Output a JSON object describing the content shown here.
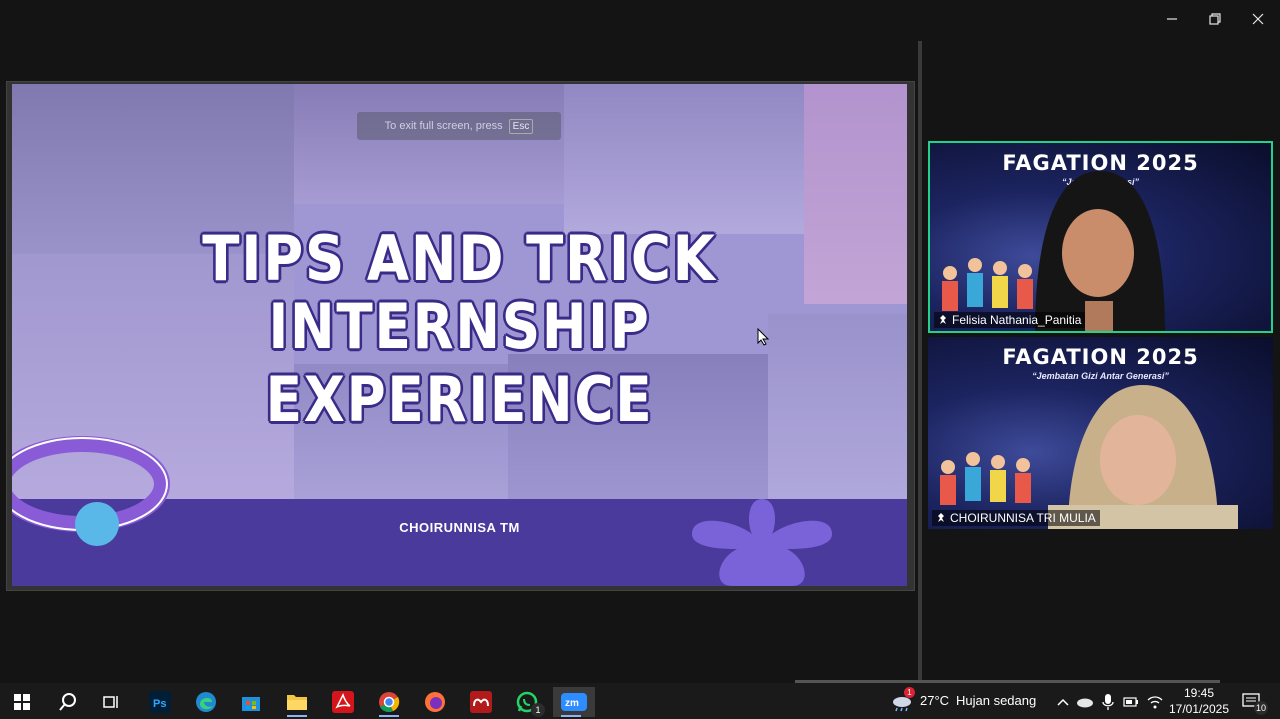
{
  "window_controls": {
    "minimize": "minimize",
    "restore": "restore",
    "close": "close"
  },
  "slide": {
    "esc_hint_text": "To exit full screen, press",
    "esc_key": "Esc",
    "title_line_1": "TIPS AND TRICK",
    "title_line_2": "INTERNSHIP EXPERIENCE",
    "presenter": "CHOIRUNNISA TM"
  },
  "participants": [
    {
      "event_title": "FAGATION 2025",
      "event_subtitle": "“Jem… Generasi”",
      "name": "Felisia Nathania_Panitia",
      "active_speaker": true
    },
    {
      "event_title": "FAGATION 2025",
      "event_subtitle": "“Jembatan Gizi Antar Generasi”",
      "name": "CHOIRUNNISA TRI MULIA",
      "active_speaker": false
    }
  ],
  "taskbar": {
    "apps": [
      "start",
      "search",
      "task-view",
      "photoshop",
      "edge",
      "store",
      "file-explorer",
      "acrobat",
      "chrome",
      "firefox",
      "mendeley",
      "whatsapp",
      "zoom"
    ],
    "whatsapp_badge": "1",
    "weather_badge": "1",
    "temperature": "27°C",
    "weather": "Hujan sedang",
    "time": "19:45",
    "date": "17/01/2025",
    "notifications": "10"
  },
  "colors": {
    "accent_green": "#23d18b",
    "slide_footer": "#4a3a9c",
    "title_outline": "#3a2b88"
  }
}
